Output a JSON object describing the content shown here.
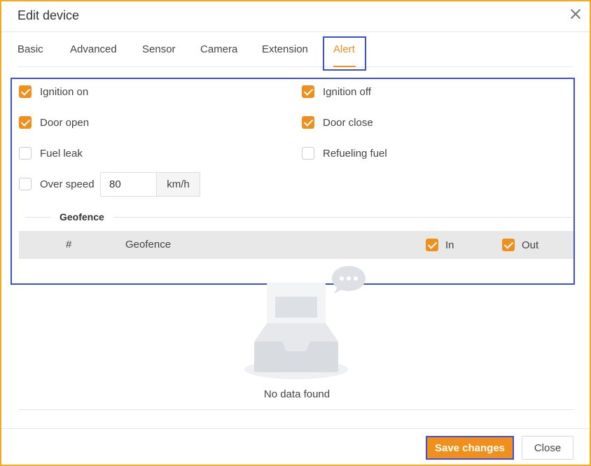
{
  "dialog": {
    "title": "Edit device"
  },
  "tabs": [
    {
      "label": "Basic"
    },
    {
      "label": "Advanced"
    },
    {
      "label": "Sensor"
    },
    {
      "label": "Camera"
    },
    {
      "label": "Extension"
    },
    {
      "label": "Alert",
      "active": true
    }
  ],
  "alerts": {
    "ignition_on": {
      "label": "Ignition on",
      "checked": true
    },
    "ignition_off": {
      "label": "Ignition off",
      "checked": true
    },
    "door_open": {
      "label": "Door open",
      "checked": true
    },
    "door_close": {
      "label": "Door close",
      "checked": true
    },
    "fuel_leak": {
      "label": "Fuel leak",
      "checked": false
    },
    "refueling_fuel": {
      "label": "Refueling fuel",
      "checked": false
    },
    "over_speed": {
      "label": "Over speed",
      "checked": false,
      "value": "80",
      "unit": "km/h"
    }
  },
  "geofence": {
    "heading": "Geofence",
    "columns": {
      "index": "#",
      "name": "Geofence",
      "in": "In",
      "out": "Out"
    },
    "in_checked": true,
    "out_checked": true,
    "empty_text": "No data found"
  },
  "footer": {
    "save_label": "Save changes",
    "close_label": "Close"
  },
  "colors": {
    "accent": "#f0901a",
    "highlight": "#3d4fe0",
    "frame": "#f5a91d"
  },
  "icons": {
    "close": "close-icon",
    "empty": "empty-inbox-icon"
  }
}
